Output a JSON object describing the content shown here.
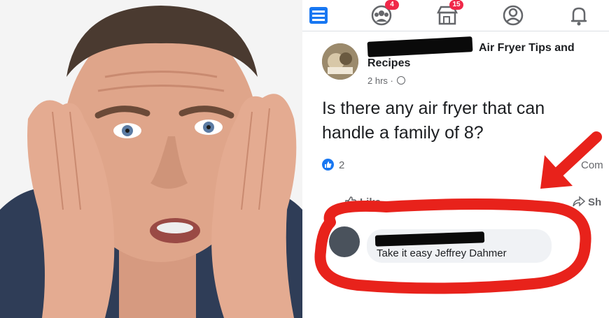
{
  "navbar": {
    "groups_badge": "4",
    "marketplace_badge": "15"
  },
  "post": {
    "group_name_line1": "Air Fryer Tips and",
    "group_name_line2": "Recipes",
    "timestamp": "2 hrs ·",
    "text_line1": "Is there any air fryer that can",
    "text_line2": "handle a family of 8?",
    "reaction_count": "2",
    "comments_label": "Com"
  },
  "actions": {
    "like": "Like",
    "share": "Sh"
  },
  "comment": {
    "text": "Take it easy Jeffrey Dahmer"
  },
  "colors": {
    "facebook_blue": "#1877f2",
    "badge_red": "#f02849",
    "annotation_red": "#e8221b",
    "comment_bubble": "#f0f2f5"
  },
  "icons": [
    "menu-icon",
    "groups-icon",
    "marketplace-icon",
    "profile-icon",
    "bell-icon",
    "globe-icon",
    "like-icon",
    "share-icon"
  ]
}
